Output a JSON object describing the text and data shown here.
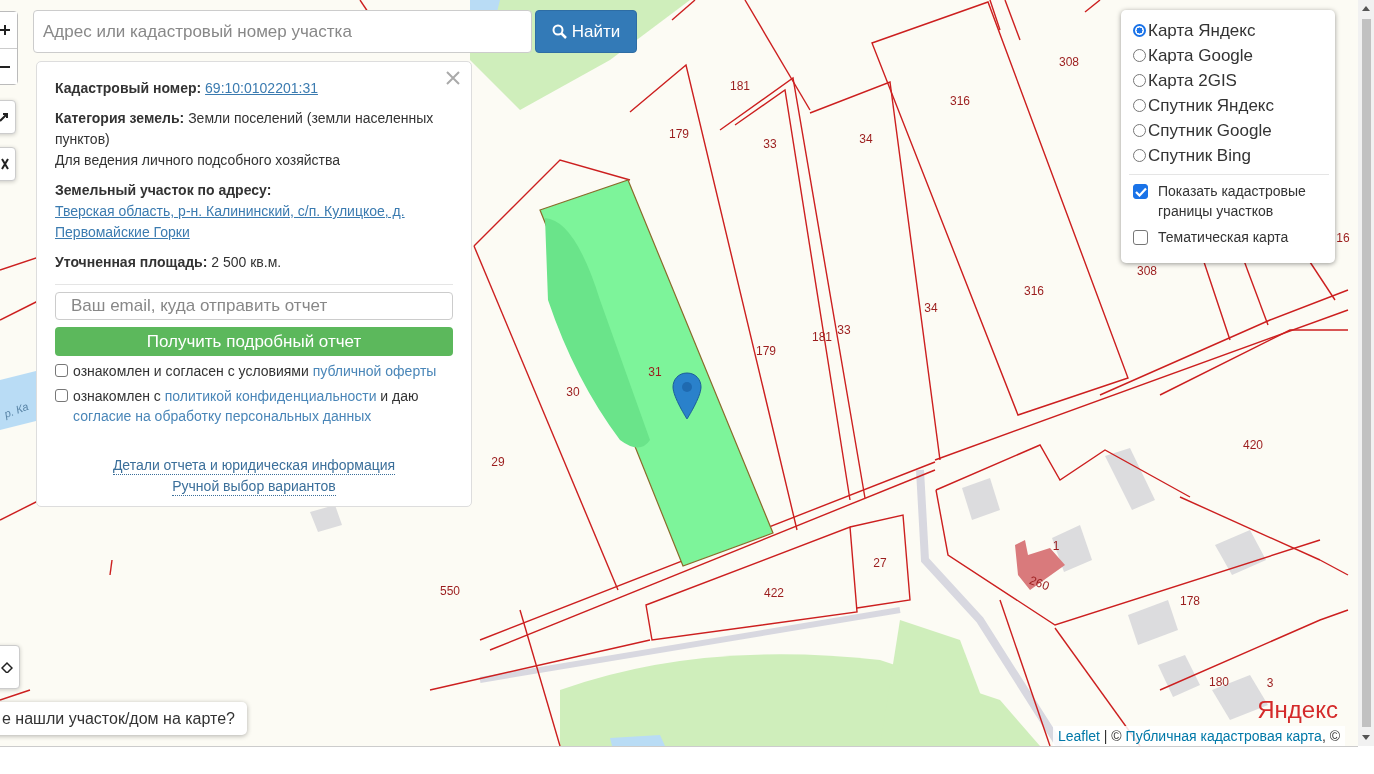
{
  "search": {
    "placeholder": "Адрес или кадастровый номер участка",
    "button": "Найти"
  },
  "info_panel": {
    "fields": [
      {
        "label": "Кадастровый номер:",
        "value": "69:10:0102201:31",
        "kind": "link"
      },
      {
        "label": "Категория земель:",
        "value": "Земли поселений (земли населенных пунктов)",
        "kind": "text",
        "note": "Для ведения личного подсобного хозяйства"
      },
      {
        "label": "Земельный участок по адресу:",
        "value": "Тверская область, р-н. Калининский, с/п. Кулицкое, д. Первомайские Горки",
        "kind": "link"
      },
      {
        "label": "Уточненная площадь:",
        "value": "2 500 кв.м.",
        "kind": "text"
      }
    ],
    "email_placeholder": "Ваш email, куда отправить отчет",
    "report_button": "Получить подробный отчет",
    "agreements": [
      {
        "checked": false,
        "parts": [
          {
            "text": "ознакомлен и согласен с условиями ",
            "kind": "text"
          },
          {
            "text": "публичной оферты",
            "kind": "link"
          }
        ]
      },
      {
        "checked": false,
        "parts": [
          {
            "text": "ознакомлен с ",
            "kind": "text"
          },
          {
            "text": "политикой конфиденциальности",
            "kind": "link"
          },
          {
            "text": " и даю ",
            "kind": "text"
          },
          {
            "text": "согласие на обработку персональных данных",
            "kind": "link"
          }
        ]
      }
    ],
    "footer_links": [
      "Детали отчета и юридическая информация",
      "Ручной выбор вариантов"
    ]
  },
  "layers": {
    "base": [
      {
        "label": "Карта Яндекс",
        "selected": true
      },
      {
        "label": "Карта Google",
        "selected": false
      },
      {
        "label": "Карта 2GIS",
        "selected": false
      },
      {
        "label": "Спутник Яндекс",
        "selected": false
      },
      {
        "label": "Спутник Google",
        "selected": false
      },
      {
        "label": "Спутник Bing",
        "selected": false
      }
    ],
    "overlays": [
      {
        "label": "Показать кадастровые границы участков",
        "checked": true
      },
      {
        "label": "Тематическая карта",
        "checked": false
      }
    ]
  },
  "map": {
    "parcel_labels": [
      "308",
      "181",
      "316",
      "179",
      "33",
      "34",
      "316",
      "34",
      "308",
      "179",
      "181",
      "33",
      "31",
      "30",
      "29",
      "420",
      "1",
      "260",
      "27",
      "422",
      "178",
      "550",
      "180",
      "3",
      "16"
    ],
    "river_label": "р. Ка",
    "logo": "Яндекс"
  },
  "not_found_button": "е нашли участок/дом на карте?",
  "attribution": [
    {
      "text": "Leaflet",
      "kind": "link"
    },
    {
      "text": " | © ",
      "kind": "text"
    },
    {
      "text": "Публичная кадастровая карта",
      "kind": "link"
    },
    {
      "text": ", ©",
      "kind": "text"
    }
  ]
}
